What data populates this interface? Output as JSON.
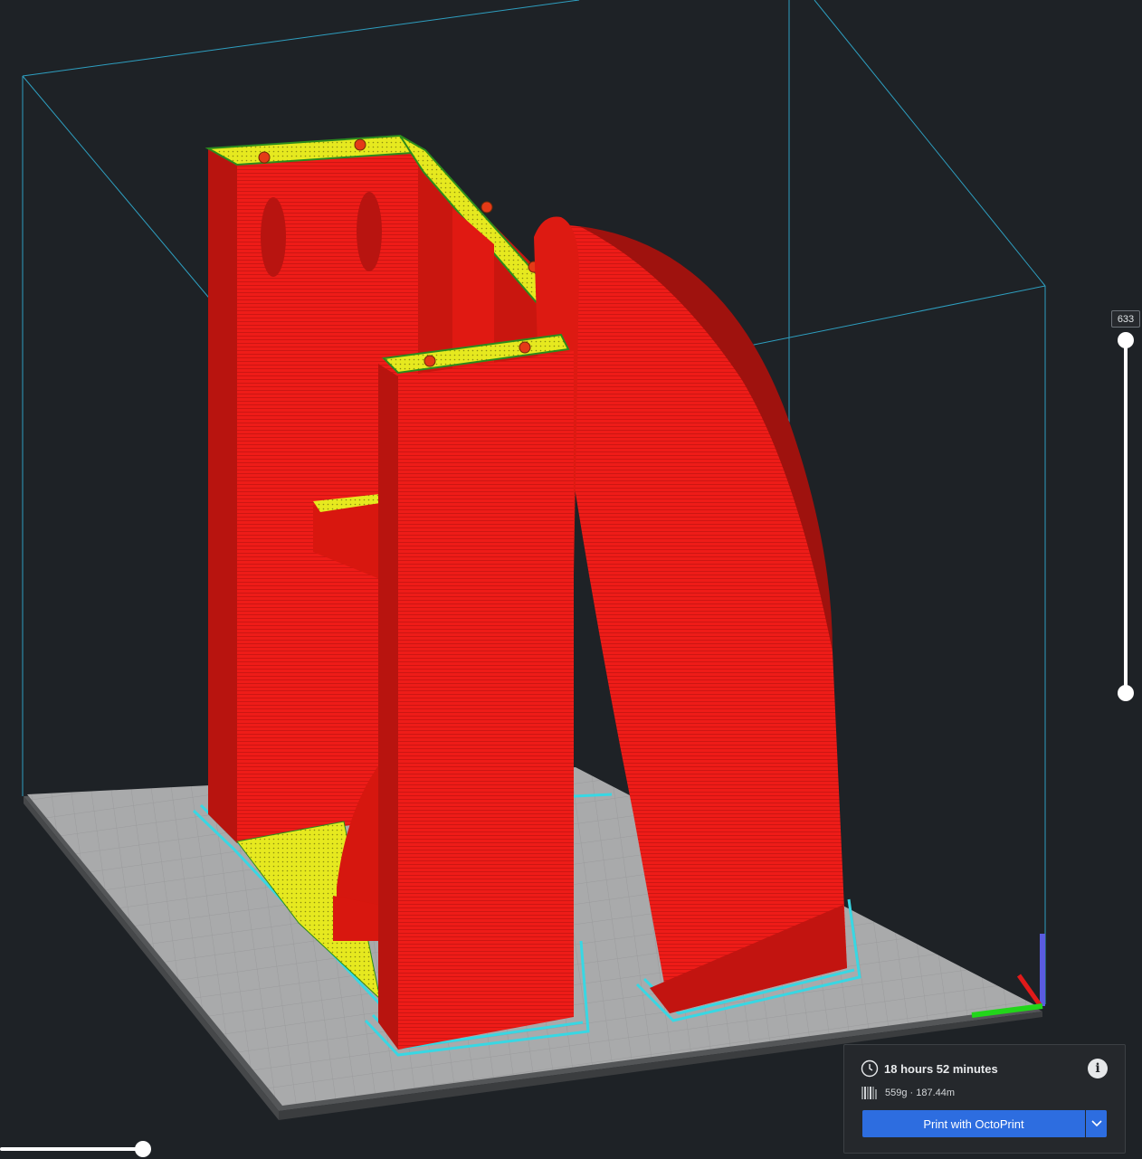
{
  "layer_view": {
    "current_layer": "633"
  },
  "print_info": {
    "time": "18 hours 52 minutes",
    "material": "559g · 187.44m",
    "info_icon": "info-icon"
  },
  "actions": {
    "print_label": "Print with OctoPrint",
    "dropdown_icon": "chevron-down-icon"
  },
  "colors": {
    "background": "#1e2226",
    "build_plate": "#a9aaab",
    "wall": "#ee1c18",
    "top_skin": "#e6e91f",
    "skirt": "#38d7e3",
    "accent_button": "#2d6de0",
    "volume_lines": "#2e9fc0"
  }
}
